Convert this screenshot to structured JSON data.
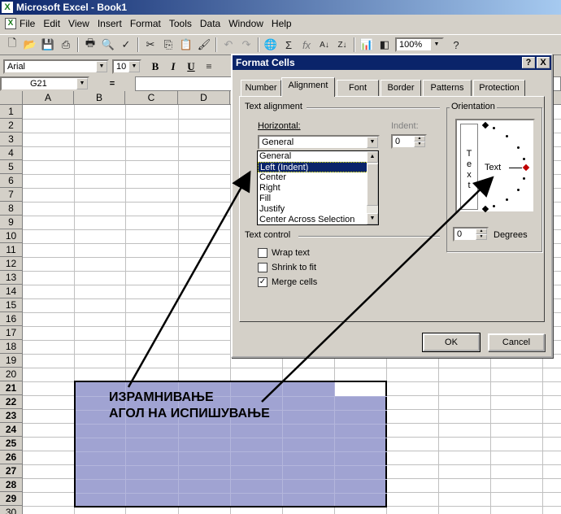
{
  "window": {
    "title": "Microsoft Excel - Book1",
    "app_icon": "excel-icon"
  },
  "menu": [
    "File",
    "Edit",
    "View",
    "Insert",
    "Format",
    "Tools",
    "Data",
    "Window",
    "Help"
  ],
  "toolbar": {
    "zoom": "100%"
  },
  "format_bar": {
    "font": "Arial",
    "size": "10"
  },
  "name_box": "G21",
  "formula_eq": "=",
  "columns": [
    "A",
    "B",
    "C",
    "D"
  ],
  "rows": [
    "1",
    "2",
    "3",
    "4",
    "5",
    "6",
    "7",
    "8",
    "9",
    "10",
    "11",
    "12",
    "13",
    "14",
    "15",
    "16",
    "17",
    "18",
    "19",
    "20",
    "21",
    "22",
    "23",
    "24",
    "25",
    "26",
    "27",
    "28",
    "29",
    "30"
  ],
  "annotation": {
    "line1": "ИЗРАМНИВАЊЕ",
    "line2": "АГОЛ НА ИСПИШУВАЊЕ"
  },
  "dialog": {
    "title": "Format Cells",
    "help_btn": "?",
    "close_btn": "X",
    "tabs": [
      "Number",
      "Alignment",
      "Font",
      "Border",
      "Patterns",
      "Protection"
    ],
    "active_tab": "Alignment",
    "text_alignment": {
      "group_label": "Text alignment",
      "horizontal_label": "Horizontal:",
      "horizontal_value": "General",
      "options": [
        "General",
        "Left (Indent)",
        "Center",
        "Right",
        "Fill",
        "Justify",
        "Center Across Selection"
      ],
      "highlighted_option": "Left (Indent)",
      "indent_label": "Indent:",
      "indent_value": "0"
    },
    "text_control": {
      "group_label": "Text control",
      "wrap_text": {
        "label": "Wrap text",
        "checked": false
      },
      "shrink_to_fit": {
        "label": "Shrink to fit",
        "checked": false
      },
      "merge_cells": {
        "label": "Merge cells",
        "checked": true
      }
    },
    "orientation": {
      "group_label": "Orientation",
      "vertical_text": [
        "T",
        "e",
        "x",
        "t"
      ],
      "dial_text": "Text",
      "degrees_value": "0",
      "degrees_label": "Degrees"
    },
    "ok_label": "OK",
    "cancel_label": "Cancel"
  }
}
